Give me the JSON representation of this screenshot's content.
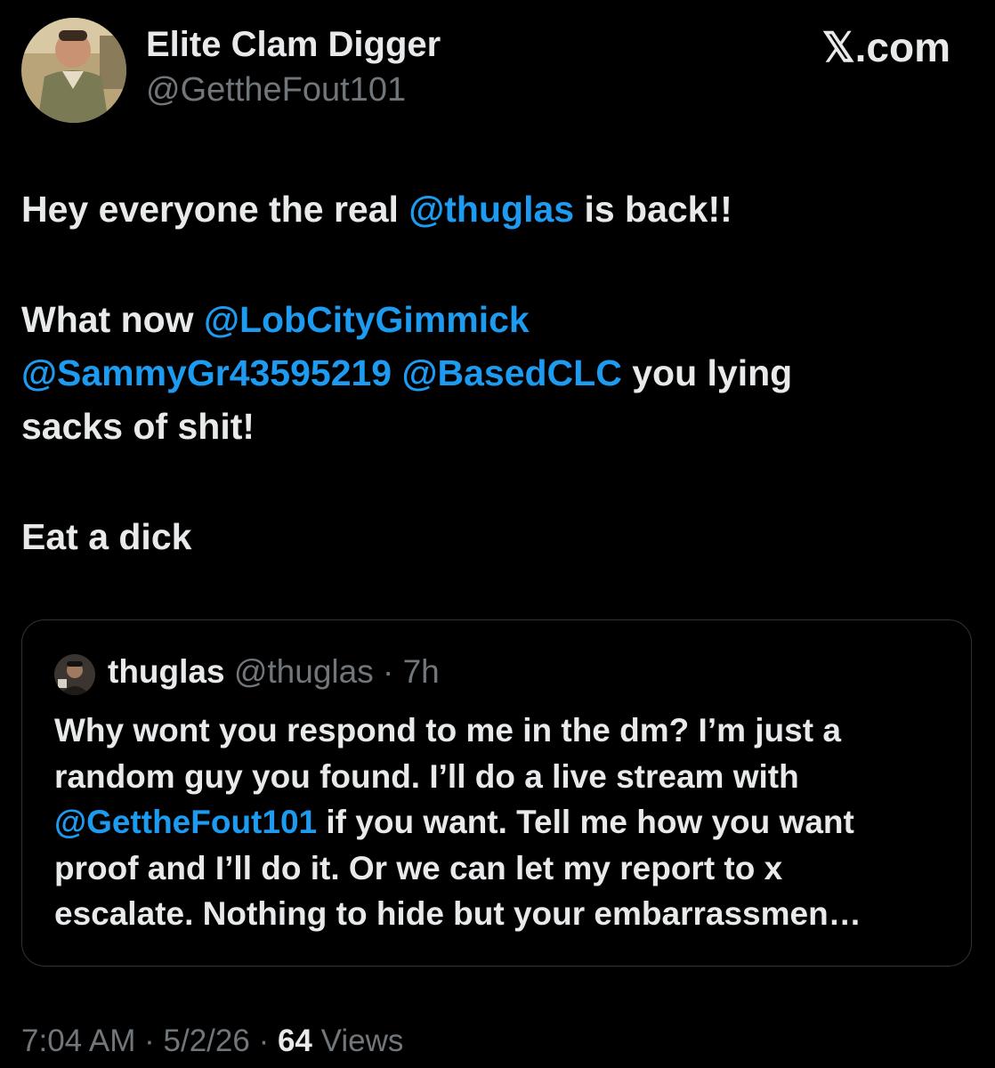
{
  "author": {
    "display_name": "Elite Clam Digger",
    "handle": "@GettheFout101"
  },
  "brand": {
    "logo_text": "𝕏.com"
  },
  "tweet": {
    "line1_before": "Hey everyone the real ",
    "line1_mention": "@thuglas",
    "line1_after": " is back!!",
    "para2_prefix": "What now ",
    "mention_lobcity": "@LobCityGimmick",
    "mention_sammy": "@SammyGr43595219",
    "mention_based": "@BasedCLC",
    "para2_suffix_a": " you lying",
    "para2_suffix_b": "sacks of shit!",
    "para3": "Eat a dick"
  },
  "quoted_tweet": {
    "display_name": "thuglas",
    "handle": "@thuglas",
    "separator": " · ",
    "age": "7h",
    "text_line1": "Why wont you respond to me in the dm? I’m just a",
    "text_line2": "random guy you found. I’ll do a live stream with",
    "mention": "@GettheFout101",
    "text_line3_rest": " if you want. Tell me how you want",
    "text_line4": "proof and I’ll do it. Or we can let my report to x",
    "text_line5": "escalate. Nothing to hide but your embarrassmen…"
  },
  "meta": {
    "time": "7:04 AM",
    "date": "5/2/26",
    "separator": " · ",
    "views_count": "64",
    "views_label": " Views"
  },
  "colors": {
    "background": "#000000",
    "text": "#e7e9ea",
    "muted": "#71767b",
    "link": "#1d9bf0",
    "border": "#2f3336"
  }
}
